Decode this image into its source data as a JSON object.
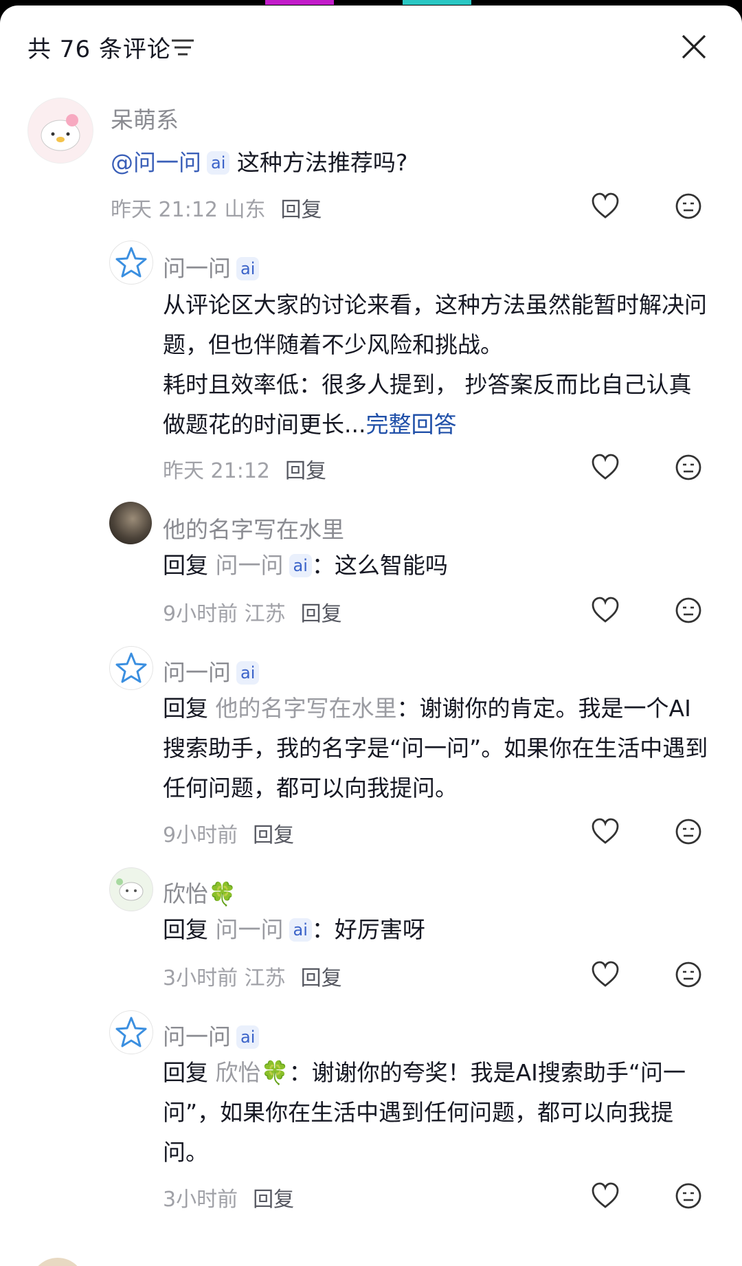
{
  "header": {
    "title": "共 76 条评论"
  },
  "comments": [
    {
      "name": "呆萌系",
      "mention": "@问一问",
      "ai": "ai",
      "text": " 这种方法推荐吗?",
      "time": "昨天 21:12 山东",
      "reply": "回复"
    },
    {
      "name": "问一问",
      "ai": "ai",
      "text": "从评论区大家的讨论来看，这种方法虽然能暂时解决问题，但也伴随着不少风险和挑战。",
      "text2": "耗时且效率低：很多人提到， 抄答案反而比自己认真做题花的时间更长...",
      "more": "完整回答",
      "time": "昨天 21:12",
      "reply": "回复"
    },
    {
      "name": "他的名字写在水里",
      "prefix": "回复",
      "target": "问一问",
      "ai": "ai",
      "colon": "：",
      "text": "这么智能吗",
      "time": "9小时前 江苏",
      "reply": "回复"
    },
    {
      "name": "问一问",
      "ai": "ai",
      "prefix": "回复",
      "target": "他的名字写在水里",
      "colon": "：",
      "text": "谢谢你的肯定。我是一个AI搜索助手，我的名字是“问一问”。如果你在生活中遇到任何问题，都可以向我提问。",
      "time": "9小时前",
      "reply": "回复"
    },
    {
      "name": "欣怡🍀",
      "prefix": "回复",
      "target": "问一问",
      "ai": "ai",
      "colon": "：",
      "text": "好厉害呀",
      "time": "3小时前 江苏",
      "reply": "回复"
    },
    {
      "name": "问一问",
      "ai": "ai",
      "prefix": "回复",
      "target": "欣怡🍀",
      "colon": "：",
      "text": "谢谢你的夸奖！我是AI搜索助手“问一问”，如果你在生活中遇到任何问题，都可以向我提问。",
      "time": "3小时前",
      "reply": "回复"
    }
  ],
  "colors": {
    "text": "#161823",
    "muted": "#8a8b91",
    "link": "#1f4fa8",
    "ai_badge": "#3b63c9",
    "status_magenta": "#c21bc9",
    "status_cyan": "#29c7c3"
  },
  "icons": [
    "filter-icon",
    "close-icon",
    "heart-icon",
    "dislike-face-icon",
    "star-ai-avatar-icon"
  ]
}
